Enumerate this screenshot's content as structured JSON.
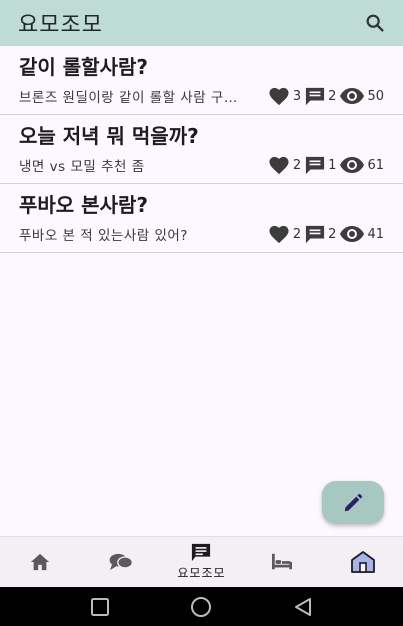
{
  "app": {
    "title": "요모조모"
  },
  "posts": [
    {
      "title": "같이 롤할사람?",
      "preview": "브론즈 원딜이랑 같이 롤할 사람 구해요",
      "likes": "3",
      "comments": "2",
      "views": "50"
    },
    {
      "title": "오늘 저녁 뭐 먹을까?",
      "preview": "냉면 vs  모밀 추천 좀",
      "likes": "2",
      "comments": "1",
      "views": "61"
    },
    {
      "title": "푸바오 본사람?",
      "preview": "푸바오 본 적 있는사람 있어?",
      "likes": "2",
      "comments": "2",
      "views": "41"
    }
  ],
  "nav": {
    "active_label": "요모조모"
  },
  "colors": {
    "appbar": "#bedbd5",
    "fab": "#a7c7c1",
    "background": "#fdf7ff",
    "accent_icon": "#2b1f6b"
  },
  "icons": [
    "search-icon",
    "heart-icon",
    "comment-icon",
    "eye-icon",
    "edit-icon",
    "home-icon",
    "chat-icon",
    "board-icon",
    "bed-icon",
    "house-icon"
  ]
}
